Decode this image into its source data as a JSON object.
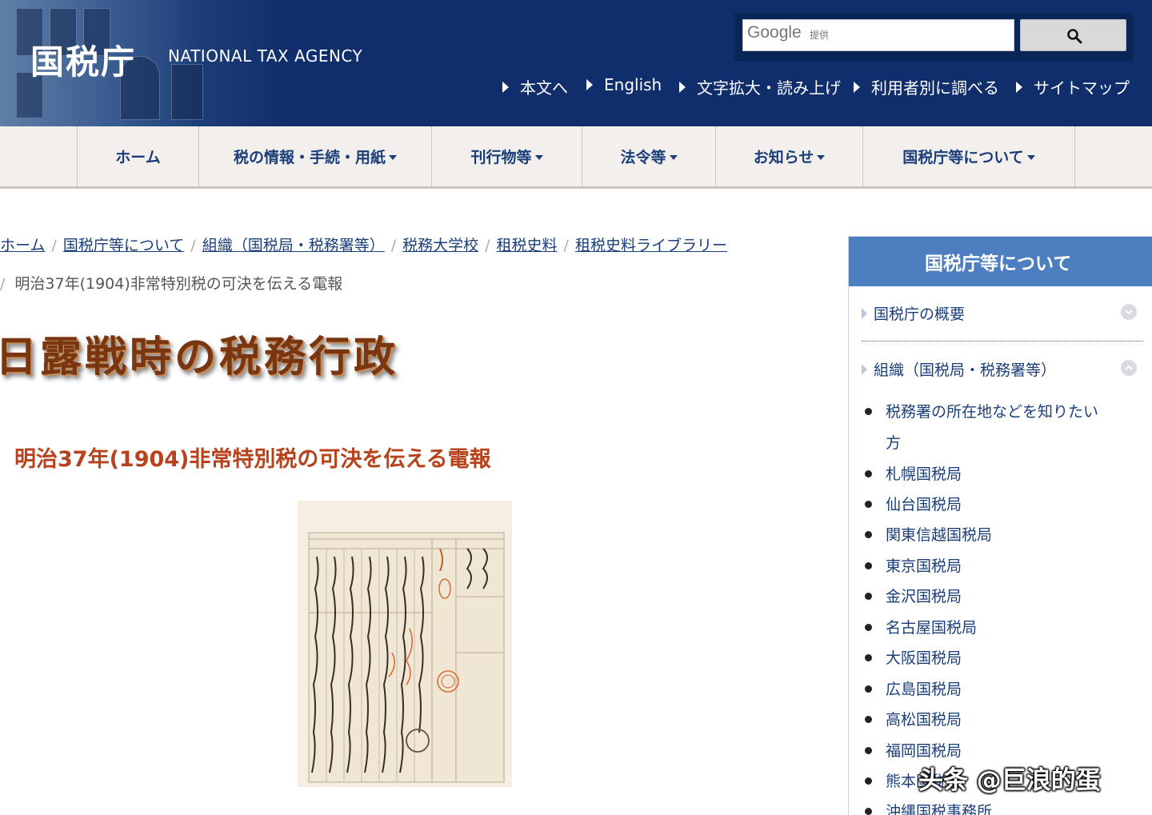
{
  "header": {
    "logo_jp": "国税庁",
    "logo_en": "NATIONAL TAX AGENCY",
    "search": {
      "brand": "Google",
      "provided": "提供",
      "value": "",
      "button_icon": "search-icon"
    },
    "utility_links": [
      "本文へ",
      "English",
      "文字拡大・読み上げ",
      "利用者別に調べる",
      "サイトマップ"
    ]
  },
  "nav": {
    "items": [
      {
        "label": "ホーム",
        "dropdown": false
      },
      {
        "label": "税の情報・手続・用紙",
        "dropdown": true
      },
      {
        "label": "刊行物等",
        "dropdown": true
      },
      {
        "label": "法令等",
        "dropdown": true
      },
      {
        "label": "お知らせ",
        "dropdown": true
      },
      {
        "label": "国税庁等について",
        "dropdown": true
      }
    ]
  },
  "breadcrumb": {
    "links": [
      "ホーム",
      "国税庁等について",
      "組織（国税局・税務署等）",
      "税務大学校",
      "租税史料",
      "租税史料ライブラリー"
    ],
    "separator": "/",
    "current": "明治37年(1904)非常特別税の可決を伝える電報"
  },
  "main": {
    "banner_title": "日露戦時の税務行政",
    "heading": "明治37年(1904)非常特別税の可決を伝える電報"
  },
  "sidebar": {
    "title": "国税庁等について",
    "items": [
      {
        "label": "国税庁の概要",
        "expanded": false
      },
      {
        "label": "組織（国税局・税務署等）",
        "expanded": true
      }
    ],
    "subitems": [
      "税務署の所在地などを知りたい",
      "方",
      "札幌国税局",
      "仙台国税局",
      "関東信越国税局",
      "東京国税局",
      "金沢国税局",
      "名古屋国税局",
      "大阪国税局",
      "広島国税局",
      "高松国税局",
      "福岡国税局",
      "熊本国税局",
      "沖縄国税事務所"
    ]
  },
  "watermark": "头条 @巨浪的蛋",
  "colors": {
    "header_bg": "#0f2e6b",
    "nav_bg": "#f2efec",
    "nav_text": "#1a3e7a",
    "heading": "#b8421b",
    "sidebar_head": "#4d7fc0"
  }
}
